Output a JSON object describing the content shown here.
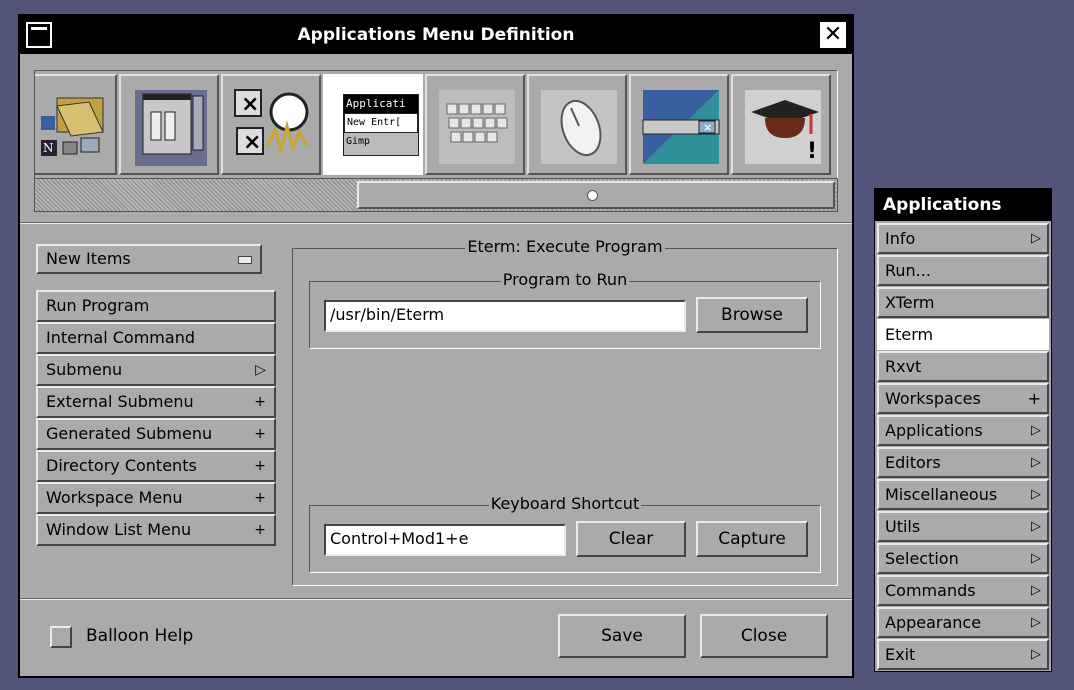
{
  "window": {
    "title": "Applications Menu Definition"
  },
  "icon_tiles": [
    "menu-icons-tile",
    "window-icons-tile",
    "window-buttons-tile",
    "menu-editor-tile",
    "keyboard-tile",
    "mouse-tile",
    "appearance-tile",
    "expert-tile"
  ],
  "icon_tile_selected": 3,
  "menu_editor_tile": {
    "line1": "Applicati",
    "line2": "New Entr[",
    "line3": "Gimp"
  },
  "left": {
    "new_items": "New Items",
    "buttons": [
      {
        "label": "Run Program",
        "mark": ""
      },
      {
        "label": "Internal Command",
        "mark": ""
      },
      {
        "label": "Submenu",
        "mark": "▷"
      },
      {
        "label": "External Submenu",
        "mark": "+"
      },
      {
        "label": "Generated Submenu",
        "mark": "+"
      },
      {
        "label": "Directory Contents",
        "mark": "+"
      },
      {
        "label": "Workspace Menu",
        "mark": "+"
      },
      {
        "label": "Window List Menu",
        "mark": "+"
      }
    ]
  },
  "editor": {
    "group_title": "Eterm: Execute Program",
    "program_title": "Program to Run",
    "program_value": "/usr/bin/Eterm",
    "browse": "Browse",
    "shortcut_title": "Keyboard Shortcut",
    "shortcut_value": "Control+Mod1+e",
    "clear": "Clear",
    "capture": "Capture"
  },
  "footer": {
    "balloon_help": "Balloon Help",
    "save": "Save",
    "close": "Close"
  },
  "app_menu": {
    "title": "Applications",
    "items": [
      {
        "label": "Info",
        "mark": "▷"
      },
      {
        "label": "Run...",
        "mark": ""
      },
      {
        "label": "XTerm",
        "mark": ""
      },
      {
        "label": "Eterm",
        "mark": ""
      },
      {
        "label": "Rxvt",
        "mark": ""
      },
      {
        "label": "Workspaces",
        "mark": "+"
      },
      {
        "label": "Applications",
        "mark": "▷"
      },
      {
        "label": "Editors",
        "mark": "▷"
      },
      {
        "label": "Miscellaneous",
        "mark": "▷"
      },
      {
        "label": "Utils",
        "mark": "▷"
      },
      {
        "label": "Selection",
        "mark": "▷"
      },
      {
        "label": "Commands",
        "mark": "▷"
      },
      {
        "label": "Appearance",
        "mark": "▷"
      },
      {
        "label": "Exit",
        "mark": "▷"
      }
    ],
    "selected": "Eterm"
  },
  "colors": {
    "desktop": "#525479",
    "window": "#aaaaaa",
    "titlebar": "#000000"
  }
}
